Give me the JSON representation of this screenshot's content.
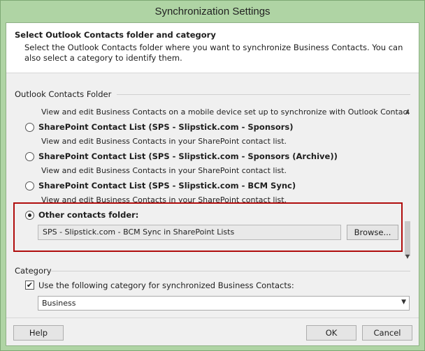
{
  "window": {
    "title": "Synchronization Settings"
  },
  "header": {
    "title": "Select Outlook Contacts folder and category",
    "description": "Select the Outlook Contacts folder where you want to synchronize Business Contacts.  You can also select a category to identify them."
  },
  "folder_group": {
    "label": "Outlook Contacts Folder",
    "top_desc": "View and edit Business Contacts on a mobile device set up to synchronize with Outlook Contacts.",
    "options": [
      {
        "label": "SharePoint Contact List (SPS - Slipstick.com - Sponsors)",
        "desc": "View and edit Business Contacts in your SharePoint contact list.",
        "selected": false
      },
      {
        "label": "SharePoint Contact List (SPS - Slipstick.com - Sponsors (Archive))",
        "desc": "View and edit Business Contacts in your SharePoint contact list.",
        "selected": false
      },
      {
        "label": "SharePoint Contact List (SPS - Slipstick.com - BCM Sync)",
        "desc": "View and edit Business Contacts in your SharePoint contact list.",
        "selected": false
      }
    ],
    "other": {
      "label": "Other contacts folder:",
      "value": "SPS - Slipstick.com - BCM Sync in SharePoint Lists",
      "browse_label": "Browse...",
      "selected": true
    }
  },
  "category_group": {
    "label": "Category",
    "checkbox_label": "Use the following category for synchronized Business Contacts:",
    "checked": true,
    "selected_value": "Business"
  },
  "footer": {
    "help_label": "Help",
    "ok_label": "OK",
    "cancel_label": "Cancel"
  },
  "colors": {
    "title_bar": "#afd4a4",
    "highlight_border": "#b00d0d",
    "dialog_bg": "#f0f0f0"
  }
}
